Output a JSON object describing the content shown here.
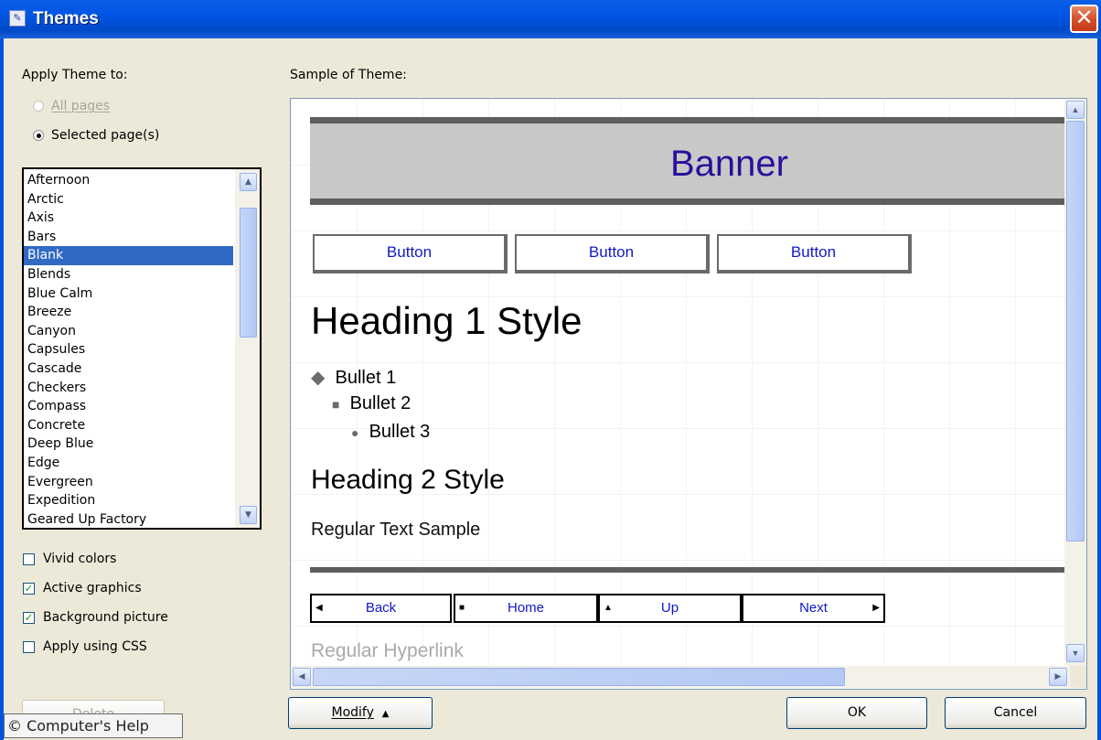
{
  "window": {
    "title": "Themes",
    "close_label": "✕"
  },
  "apply": {
    "heading": "Apply Theme to:",
    "all_pages": "All pages",
    "selected_pages": "Selected page(s)"
  },
  "themes": {
    "items": [
      "Afternoon",
      "Arctic",
      "Axis",
      "Bars",
      "Blank",
      "Blends",
      "Blue Calm",
      "Breeze",
      "Canyon",
      "Capsules",
      "Cascade",
      "Checkers",
      "Compass",
      "Concrete",
      "Deep Blue",
      "Edge",
      "Evergreen",
      "Expedition",
      "Geared Up Factory"
    ],
    "selected": "Blank"
  },
  "options": {
    "vivid": {
      "label": "Vivid colors",
      "checked": false
    },
    "active": {
      "label": "Active graphics",
      "checked": true
    },
    "background": {
      "label": "Background picture",
      "checked": true
    },
    "css": {
      "label": "Apply using CSS",
      "checked": false
    }
  },
  "buttons": {
    "delete": "Delete",
    "modify": "Modify",
    "ok": "OK",
    "cancel": "Cancel"
  },
  "sample": {
    "heading": "Sample of Theme:",
    "banner": "Banner",
    "buttons": [
      "Button",
      "Button",
      "Button"
    ],
    "heading1": "Heading 1 Style",
    "bullet1": "Bullet 1",
    "bullet2": "Bullet 2",
    "bullet3": "Bullet 3",
    "heading2": "Heading 2 Style",
    "regular_text": "Regular Text Sample",
    "nav": {
      "back": "Back",
      "home": "Home",
      "up": "Up",
      "next": "Next"
    },
    "hyperlink": "Regular Hyperlink"
  },
  "watermark": "© Computer's Help",
  "colors": {
    "titlebar": "#0054e3",
    "selection": "#316ac5",
    "banner_text": "#2a0f9a",
    "sample_button_text": "#1018c8"
  }
}
